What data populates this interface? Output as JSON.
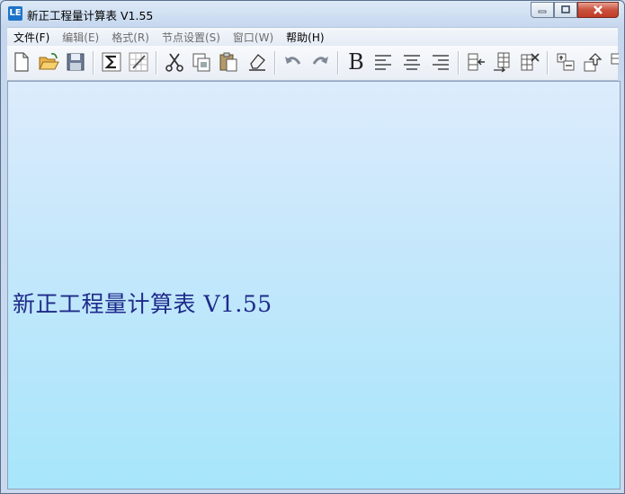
{
  "window": {
    "title": "新正工程量计算表  V1.55"
  },
  "app_icon": {
    "glyph": "LE",
    "color": "#1e73c8"
  },
  "menu": [
    {
      "label": "文件(F)",
      "dim": false
    },
    {
      "label": "编辑(E)",
      "dim": true
    },
    {
      "label": "格式(R)",
      "dim": true
    },
    {
      "label": "节点设置(S)",
      "dim": true
    },
    {
      "label": "窗口(W)",
      "dim": true
    },
    {
      "label": "帮助(H)",
      "dim": false
    }
  ],
  "toolbar": {
    "bold_glyph": "B",
    "icons": [
      "new-file-icon",
      "open-folder-icon",
      "save-icon",
      "sum-icon",
      "edit-sum-icon",
      "cut-icon",
      "copy-icon",
      "paste-icon",
      "eraser-icon",
      "undo-icon",
      "redo-icon",
      "bold-icon",
      "align-left-icon",
      "align-center-icon",
      "align-right-icon",
      "insert-row-before-icon",
      "insert-row-after-icon",
      "delete-row-icon",
      "insert-child-icon",
      "move-up-icon",
      "more-icon"
    ]
  },
  "content": {
    "splash_text": "新正工程量计算表 V1.55",
    "gradient_top": "#dcecfc",
    "gradient_bottom": "#a7e6fb",
    "text_color": "#1f2a8a"
  }
}
